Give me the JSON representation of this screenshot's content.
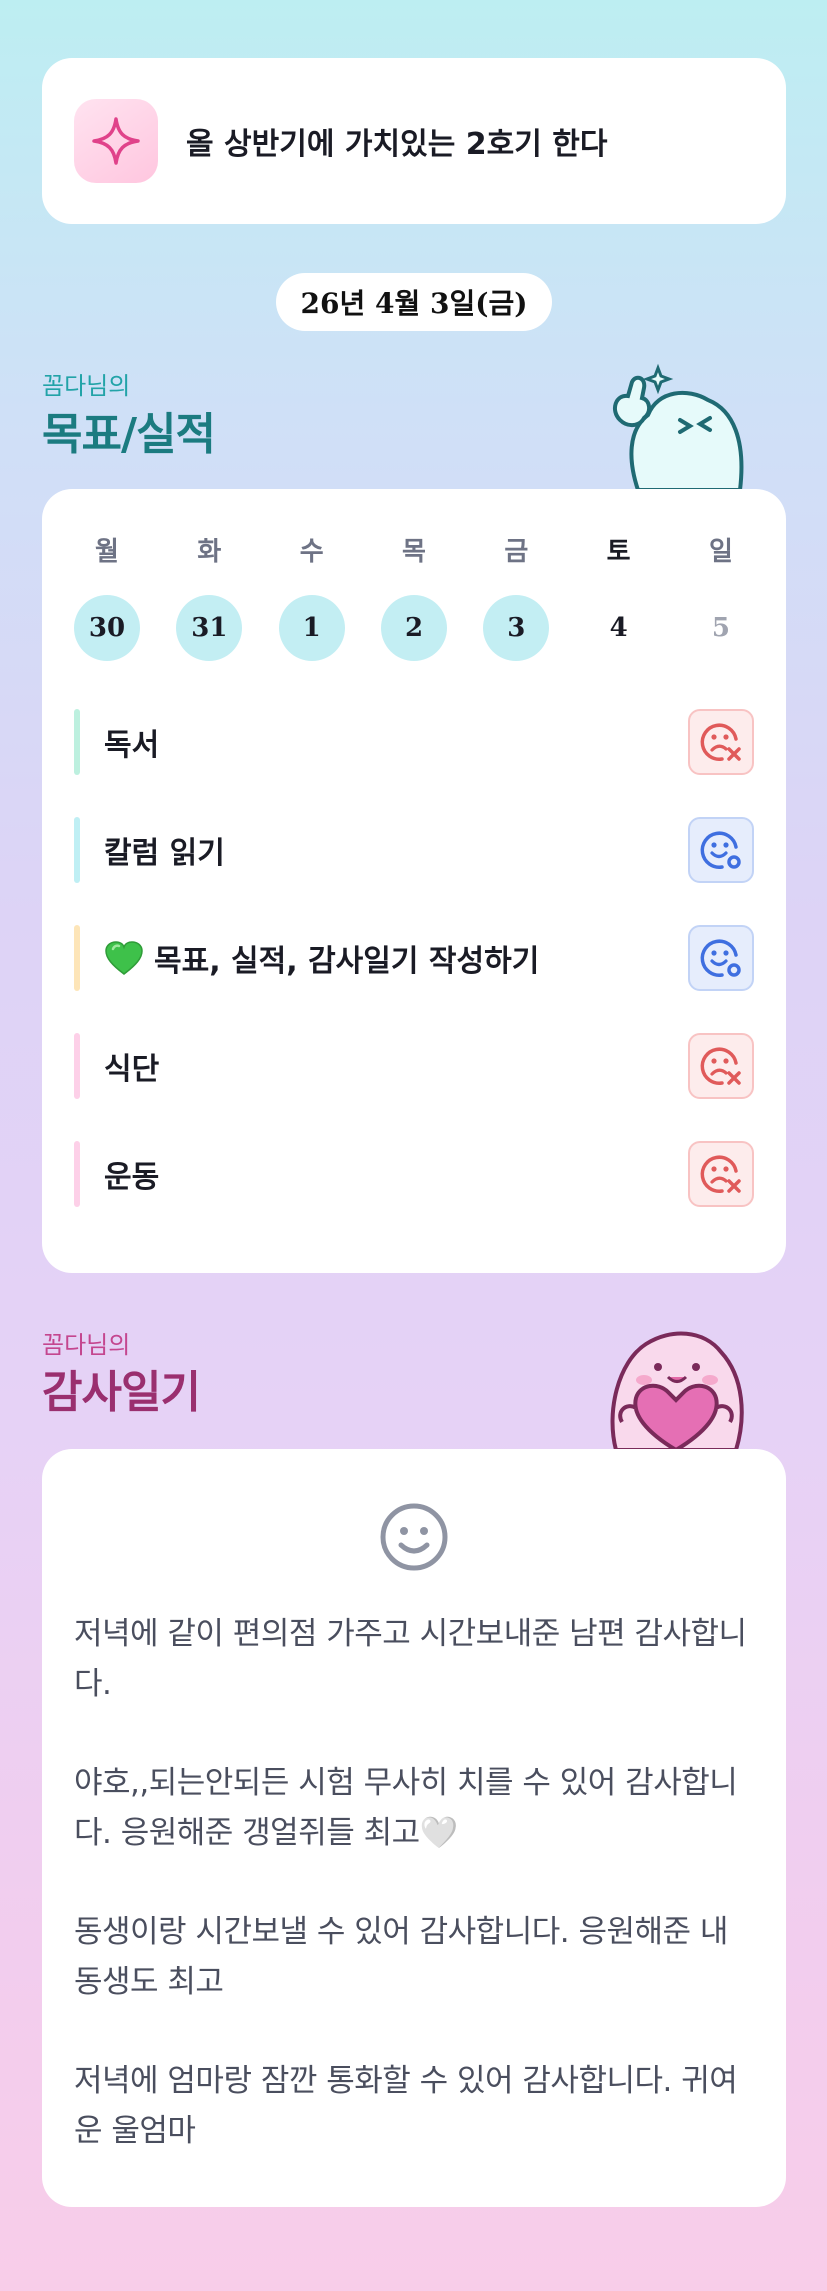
{
  "goal": {
    "icon": "sparkle-icon",
    "text": "올 상반기에 가치있는 2호기 한다"
  },
  "date_label": "26년 4월 3일(금)",
  "goals_section": {
    "subtitle": "꼼다님의",
    "title": "목표/실적"
  },
  "tracker": {
    "weekdays": [
      "월",
      "화",
      "수",
      "목",
      "금",
      "토",
      "일"
    ],
    "dates": [
      "30",
      "31",
      "1",
      "2",
      "3",
      "4",
      "5"
    ],
    "tasks": [
      {
        "label": "독서",
        "status": "bad",
        "bar_color": "#bdf0df"
      },
      {
        "label": "칼럼 읽기",
        "status": "good",
        "bar_color": "#bfeff4"
      },
      {
        "label": "목표, 실적, 감사일기 작성하기",
        "status": "good",
        "bar_color": "#fde5b8"
      },
      {
        "label": "식단",
        "status": "bad",
        "bar_color": "#fdd0e8"
      },
      {
        "label": "운동",
        "status": "bad",
        "bar_color": "#fdd0e8"
      }
    ],
    "status_icons": {
      "bad": "sad-face-x-icon",
      "good": "smile-face-o-icon"
    }
  },
  "gratitude_section": {
    "subtitle": "꼼다님의",
    "title": "감사일기"
  },
  "gratitude": {
    "icon": "smile-icon",
    "entries": [
      "저녁에 같이 편의점 가주고 시간보내준 남편 감사합니다.",
      "야호,,되는안되든 시험 무사히 치를 수 있어 감사합니다. 응원해준 갱얼쥐들 최고🤍",
      "동생이랑 시간보낼 수 있어 감사합니다. 응원해준 내 동생도 최고",
      "저녁에 엄마랑 잠깐 통화할 수 있어 감사합니다. 귀여운 울엄마"
    ]
  },
  "colors": {
    "teal_title": "#1b7b80",
    "pink_title": "#9a2f6f",
    "done_circle": "#c3eef3",
    "bad_red": "#e05a5a",
    "good_blue": "#3f6fe0"
  }
}
